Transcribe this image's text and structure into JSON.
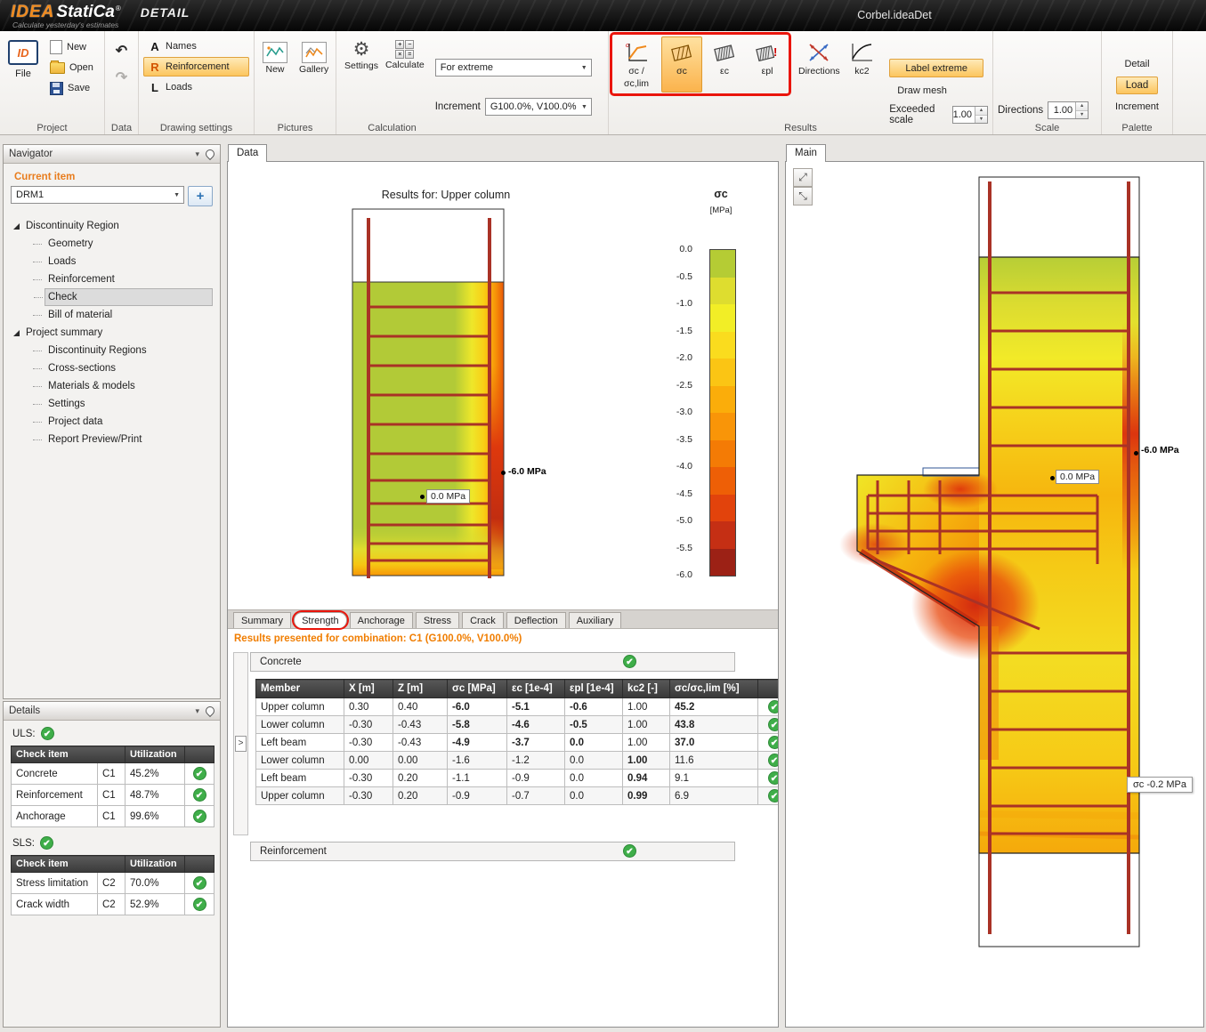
{
  "colors": {
    "accent_orange": "#f08a1d",
    "status_green": "#3fae49",
    "rebar": "#a93226",
    "annotation_red": "#ea150c",
    "heat_palette": [
      "#b5cc34",
      "#dedd2f",
      "#f2ee26",
      "#fadc1e",
      "#fbc514",
      "#fbad0a",
      "#f99508",
      "#f47b05",
      "#ee5f06",
      "#e2430c",
      "#c52f14",
      "#9c2115"
    ]
  },
  "icons": {
    "check": "✔",
    "dropdown": "▼",
    "up": "▲",
    "down": "▼",
    "undo": "↶",
    "redo": "↷",
    "gear": "⚙",
    "zoom_out": "⤢",
    "zoom_in": "⤡",
    "add": "+",
    "chevron_right": ">",
    "caret": "▾",
    "idea_logo": "ID",
    "calc_plus": "+",
    "calc_minus": "−",
    "calc_times": "×",
    "calc_eq": "="
  },
  "titlebar": {
    "logo_primary": "IDEA",
    "logo_secondary": "StatiCa",
    "logo_reg": "®",
    "logo_module": "DETAIL",
    "tagline": "Calculate yesterday's estimates",
    "document": "Corbel.ideaDet"
  },
  "ribbon": {
    "project": {
      "label": "Project",
      "file": "File",
      "new": "New",
      "open": "Open",
      "save": "Save"
    },
    "data_group": {
      "label": "Data"
    },
    "drawing": {
      "label": "Drawing settings",
      "names": "Names",
      "reinforcement": "Reinforcement",
      "loads": "Loads",
      "names_icon": "A",
      "reinforcement_icon": "R",
      "loads_icon": "L"
    },
    "pictures": {
      "label": "Pictures",
      "new": "New",
      "gallery": "Gallery"
    },
    "calculation": {
      "label": "Calculation",
      "settings": "Settings",
      "calculate": "Calculate",
      "for_extreme": "For extreme",
      "increment_label": "Increment",
      "increment_value": "G100.0%, V100.0%"
    },
    "results": {
      "label": "Results",
      "sigma_ratio_line1": "σc /",
      "sigma_ratio_line2": "σc,lim",
      "sigma_c": "σc",
      "eps_c": "εc",
      "eps_pl": "εpl",
      "directions": "Directions",
      "kc2": "kc2",
      "label_extreme": "Label extreme",
      "draw_mesh": "Draw mesh",
      "exceeded_scale": "Exceeded scale",
      "exceeded_value": "1.00"
    },
    "scale": {
      "label": "Scale",
      "directions": "Directions",
      "value": "1.00"
    },
    "palette": {
      "label": "Palette",
      "detail": "Detail",
      "load": "Load",
      "increment": "Increment"
    }
  },
  "navigator": {
    "title": "Navigator",
    "current_item_label": "Current item",
    "current_item_value": "DRM1",
    "selected_item": "Check",
    "sections": [
      {
        "label": "Discontinuity Region",
        "items": [
          "Geometry",
          "Loads",
          "Reinforcement",
          "Check",
          "Bill of material"
        ]
      },
      {
        "label": "Project summary",
        "items": [
          "Discontinuity Regions",
          "Cross-sections",
          "Materials & models",
          "Settings",
          "Project data",
          "Report Preview/Print"
        ]
      }
    ]
  },
  "details": {
    "title": "Details",
    "uls_label": "ULS:",
    "sls_label": "SLS:",
    "header_item": "Check item",
    "header_utilization": "Utilization",
    "uls_rows": [
      {
        "item": "Concrete",
        "combo": "C1",
        "utilization": "45.2%"
      },
      {
        "item": "Reinforcement",
        "combo": "C1",
        "utilization": "48.7%"
      },
      {
        "item": "Anchorage",
        "combo": "C1",
        "utilization": "99.6%"
      }
    ],
    "sls_rows": [
      {
        "item": "Stress limitation",
        "combo": "C2",
        "utilization": "70.0%"
      },
      {
        "item": "Crack width",
        "combo": "C2",
        "utilization": "52.9%"
      }
    ]
  },
  "data_panel": {
    "tab": "Data",
    "plot_title": "Results for: Upper column",
    "legend_title": "σc",
    "legend_unit": "[MPa]",
    "legend_ticks": [
      "0.0",
      "-0.5",
      "-1.0",
      "-1.5",
      "-2.0",
      "-2.5",
      "-3.0",
      "-3.5",
      "-4.0",
      "-4.5",
      "-5.0",
      "-5.5",
      "-6.0"
    ],
    "label_zero": "0.0 MPa",
    "label_min": "-6.0 MPa",
    "result_tabs": [
      "Summary",
      "Strength",
      "Anchorage",
      "Stress",
      "Crack",
      "Deflection",
      "Auxiliary"
    ],
    "active_tab": "Strength",
    "combination_note": "Results presented for combination: C1 (G100.0%, V100.0%)",
    "concrete_section": "Concrete",
    "reinforcement_section": "Reinforcement",
    "table_headers": [
      "Member",
      "X [m]",
      "Z [m]",
      "σc [MPa]",
      "εc [1e-4]",
      "εpl [1e-4]",
      "kc2 [-]",
      "σc/σc,lim [%]"
    ],
    "table_rows": [
      {
        "cells": [
          "Upper column",
          "0.30",
          "0.40",
          "-6.0",
          "-5.1",
          "-0.6",
          "1.00",
          "45.2"
        ],
        "bold": [
          3,
          4,
          5,
          7
        ]
      },
      {
        "cells": [
          "Lower column",
          "-0.30",
          "-0.43",
          "-5.8",
          "-4.6",
          "-0.5",
          "1.00",
          "43.8"
        ],
        "bold": [
          3,
          4,
          5,
          7
        ]
      },
      {
        "cells": [
          "Left beam",
          "-0.30",
          "-0.43",
          "-4.9",
          "-3.7",
          "0.0",
          "1.00",
          "37.0"
        ],
        "bold": [
          3,
          4,
          5,
          7
        ]
      },
      {
        "cells": [
          "Lower column",
          "0.00",
          "0.00",
          "-1.6",
          "-1.2",
          "0.0",
          "1.00",
          "11.6"
        ],
        "bold": [
          6
        ]
      },
      {
        "cells": [
          "Left beam",
          "-0.30",
          "0.20",
          "-1.1",
          "-0.9",
          "0.0",
          "0.94",
          "9.1"
        ],
        "bold": [
          6
        ]
      },
      {
        "cells": [
          "Upper column",
          "-0.30",
          "0.20",
          "-0.9",
          "-0.7",
          "0.0",
          "0.99",
          "6.9"
        ],
        "bold": [
          6
        ]
      }
    ]
  },
  "main_panel": {
    "tab": "Main",
    "label_min": "-6.0 MPa",
    "label_zero": "0.0 MPa",
    "tooltip": "σc -0.2 MPa"
  }
}
